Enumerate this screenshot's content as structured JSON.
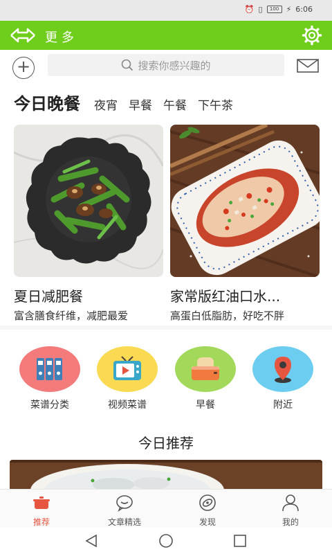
{
  "status": {
    "time": "6:06",
    "battery": "100"
  },
  "header": {
    "title": "更多",
    "accent": "#6fcd1c"
  },
  "search": {
    "placeholder": "搜索你感兴趣的"
  },
  "meal_tabs": {
    "today": "今日",
    "active": "晚餐",
    "others": [
      "夜宵",
      "早餐",
      "午餐",
      "下午茶"
    ]
  },
  "cards": [
    {
      "title": "夏日减肥餐",
      "desc": "富含膳食纤维，减肥最爱"
    },
    {
      "title": "家常版红油口水...",
      "desc": "高蛋白低脂肪，好吃不胖"
    }
  ],
  "categories": [
    {
      "label": "菜谱分类",
      "icon": "binders-icon",
      "color": "#f37b7b"
    },
    {
      "label": "视频菜谱",
      "icon": "tv-icon",
      "color": "#f9da52"
    },
    {
      "label": "早餐",
      "icon": "toaster-icon",
      "color": "#a3d95a"
    },
    {
      "label": "附近",
      "icon": "location-pin-icon",
      "color": "#6dcdf0"
    }
  ],
  "recommend": {
    "title": "今日推荐"
  },
  "bottom_nav": [
    {
      "label": "推荐",
      "icon": "pot-icon",
      "active": true
    },
    {
      "label": "文章精选",
      "icon": "chat-bubble-icon",
      "active": false
    },
    {
      "label": "发现",
      "icon": "compass-icon",
      "active": false
    },
    {
      "label": "我的",
      "icon": "user-icon",
      "active": false
    }
  ],
  "colors": {
    "active_nav": "#e5553f"
  }
}
